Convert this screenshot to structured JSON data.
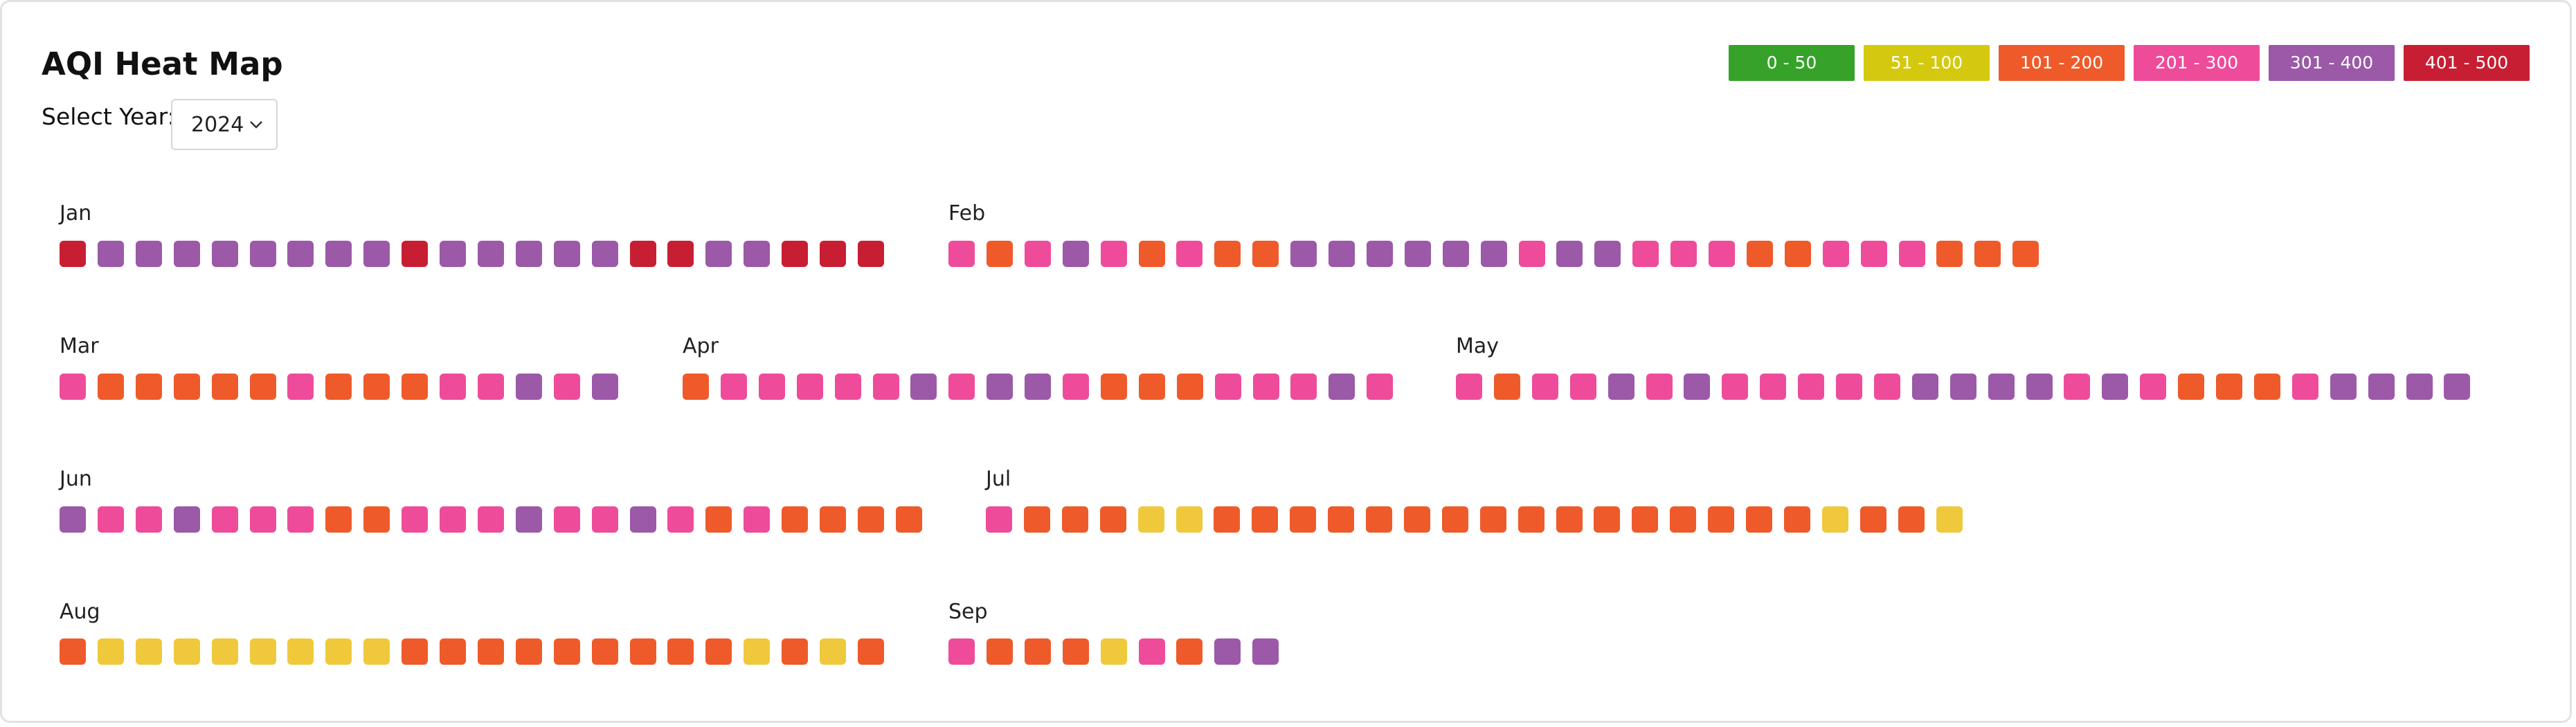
{
  "title": "AQI Heat Map",
  "year_select": {
    "label": "Select Year:",
    "value": "2024"
  },
  "legend": [
    {
      "label": "0 - 50",
      "color": "#36a22a"
    },
    {
      "label": "51 - 100",
      "color": "#d4c90e"
    },
    {
      "label": "101 - 200",
      "color": "#ef5a2a"
    },
    {
      "label": "201 - 300",
      "color": "#ee4c9a"
    },
    {
      "label": "301 - 400",
      "color": "#9b59a8"
    },
    {
      "label": "401 - 500",
      "color": "#c81e33"
    }
  ],
  "day_colors": {
    "Y": "#efc93b",
    "O": "#ef5a2a",
    "P": "#ee4c9a",
    "V": "#9b59a8",
    "R": "#c81e33"
  },
  "months": [
    {
      "name": "Jan",
      "days": [
        "R",
        "V",
        "V",
        "V",
        "V",
        "V",
        "V",
        "V",
        "V",
        "R",
        "V",
        "V",
        "V",
        "V",
        "V",
        "R",
        "R",
        "V",
        "V",
        "R",
        "R",
        "R"
      ]
    },
    {
      "name": "Feb",
      "days": [
        "P",
        "O",
        "P",
        "V",
        "P",
        "O",
        "P",
        "O",
        "O",
        "V",
        "V",
        "V",
        "V",
        "V",
        "V",
        "P",
        "V",
        "V",
        "P",
        "P",
        "P",
        "O",
        "O",
        "P",
        "P",
        "P",
        "O",
        "O",
        "O"
      ]
    },
    {
      "name": "Mar",
      "days": [
        "P",
        "O",
        "O",
        "O",
        "O",
        "O",
        "P",
        "O",
        "O",
        "O",
        "P",
        "P",
        "V",
        "P",
        "V"
      ]
    },
    {
      "name": "Apr",
      "days": [
        "O",
        "P",
        "P",
        "P",
        "P",
        "P",
        "V",
        "P",
        "V",
        "V",
        "P",
        "O",
        "O",
        "O",
        "P",
        "P",
        "P",
        "V",
        "P"
      ]
    },
    {
      "name": "May",
      "days": [
        "P",
        "O",
        "P",
        "P",
        "V",
        "P",
        "V",
        "P",
        "P",
        "P",
        "P",
        "P",
        "V",
        "V",
        "V",
        "V",
        "P",
        "V",
        "P",
        "O",
        "O",
        "O",
        "P",
        "V",
        "V",
        "V",
        "V"
      ]
    },
    {
      "name": "Jun",
      "days": [
        "V",
        "P",
        "P",
        "V",
        "P",
        "P",
        "P",
        "O",
        "O",
        "P",
        "P",
        "P",
        "V",
        "P",
        "P",
        "V",
        "P",
        "O",
        "P",
        "O",
        "O",
        "O",
        "O"
      ]
    },
    {
      "name": "Jul",
      "days": [
        "P",
        "O",
        "O",
        "O",
        "Y",
        "Y",
        "O",
        "O",
        "O",
        "O",
        "O",
        "O",
        "O",
        "O",
        "O",
        "O",
        "O",
        "O",
        "O",
        "O",
        "O",
        "O",
        "Y",
        "O",
        "O",
        "Y"
      ]
    },
    {
      "name": "Aug",
      "days": [
        "O",
        "Y",
        "Y",
        "Y",
        "Y",
        "Y",
        "Y",
        "Y",
        "Y",
        "O",
        "O",
        "O",
        "O",
        "O",
        "O",
        "O",
        "O",
        "O",
        "Y",
        "O",
        "Y",
        "O"
      ]
    },
    {
      "name": "Sep",
      "days": [
        "P",
        "O",
        "O",
        "O",
        "Y",
        "P",
        "O",
        "V",
        "V"
      ]
    }
  ]
}
